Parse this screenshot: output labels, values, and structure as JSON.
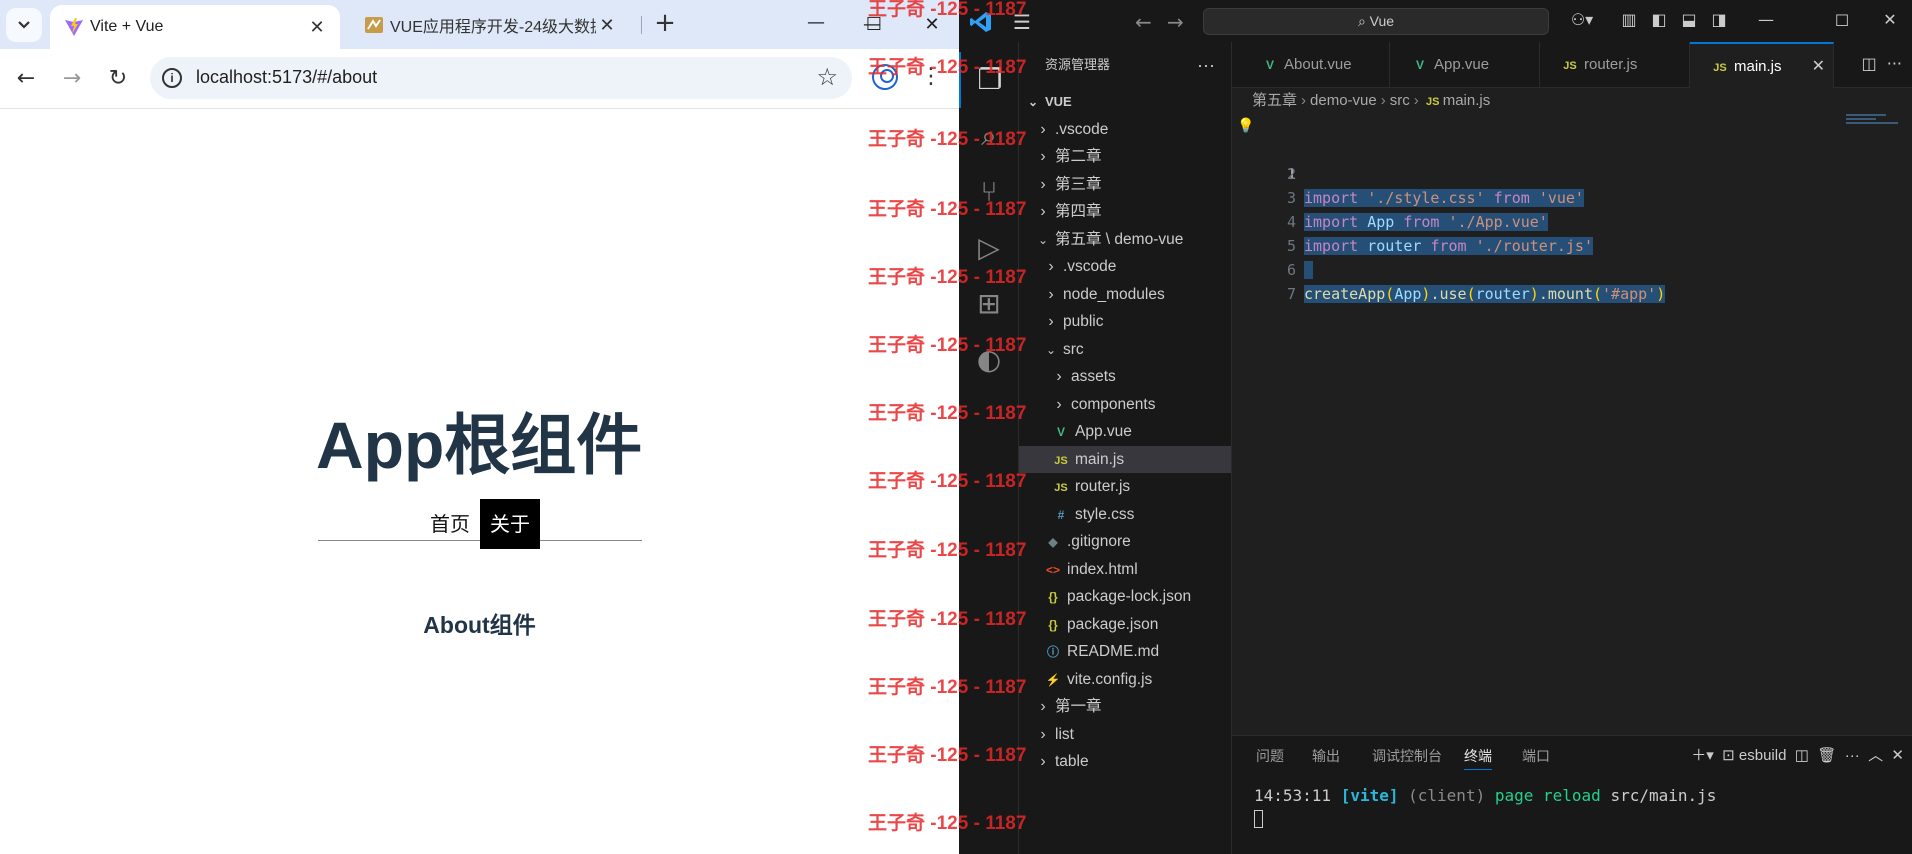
{
  "browser": {
    "tabs": [
      {
        "title": "Vite + Vue",
        "active": true
      },
      {
        "title": "VUE应用程序开发-24级大数据",
        "active": false
      }
    ],
    "url": "localhost:5173/#/about",
    "page": {
      "title": "App根组件",
      "nav": [
        {
          "label": "首页",
          "active": false
        },
        {
          "label": "关于",
          "active": true
        }
      ],
      "content": "About组件"
    }
  },
  "watermark": {
    "text": "王子奇 -125 - 1187"
  },
  "vscode": {
    "search": "Vue",
    "explorer_title": "资源管理器",
    "tree": [
      {
        "label": "VUE",
        "depth": 0,
        "type": "root",
        "expanded": true
      },
      {
        "label": ".vscode",
        "depth": 1,
        "type": "folder",
        "expanded": false
      },
      {
        "label": "第二章",
        "depth": 1,
        "type": "folder",
        "expanded": false
      },
      {
        "label": "第三章",
        "depth": 1,
        "type": "folder",
        "expanded": false
      },
      {
        "label": "第四章",
        "depth": 1,
        "type": "folder",
        "expanded": false
      },
      {
        "label": "第五章 \\ demo-vue",
        "depth": 1,
        "type": "folder",
        "expanded": true
      },
      {
        "label": ".vscode",
        "depth": 2,
        "type": "folder",
        "expanded": false
      },
      {
        "label": "node_modules",
        "depth": 2,
        "type": "folder",
        "expanded": false
      },
      {
        "label": "public",
        "depth": 2,
        "type": "folder",
        "expanded": false
      },
      {
        "label": "src",
        "depth": 2,
        "type": "folder",
        "expanded": true
      },
      {
        "label": "assets",
        "depth": 3,
        "type": "folder",
        "expanded": false
      },
      {
        "label": "components",
        "depth": 3,
        "type": "folder",
        "expanded": false
      },
      {
        "label": "App.vue",
        "depth": 3,
        "type": "vue"
      },
      {
        "label": "main.js",
        "depth": 3,
        "type": "js",
        "selected": true
      },
      {
        "label": "router.js",
        "depth": 3,
        "type": "js"
      },
      {
        "label": "style.css",
        "depth": 3,
        "type": "css"
      },
      {
        "label": ".gitignore",
        "depth": 2,
        "type": "git"
      },
      {
        "label": "index.html",
        "depth": 2,
        "type": "html"
      },
      {
        "label": "package-lock.json",
        "depth": 2,
        "type": "json"
      },
      {
        "label": "package.json",
        "depth": 2,
        "type": "json"
      },
      {
        "label": "README.md",
        "depth": 2,
        "type": "info"
      },
      {
        "label": "vite.config.js",
        "depth": 2,
        "type": "vite"
      },
      {
        "label": "第一章",
        "depth": 1,
        "type": "folder",
        "expanded": false
      },
      {
        "label": "list",
        "depth": 1,
        "type": "folder",
        "expanded": false
      },
      {
        "label": "table",
        "depth": 1,
        "type": "folder",
        "expanded": false
      }
    ],
    "editor_tabs": [
      {
        "label": "About.vue",
        "type": "vue",
        "active": false
      },
      {
        "label": "App.vue",
        "type": "vue",
        "active": false
      },
      {
        "label": "router.js",
        "type": "js",
        "active": false
      },
      {
        "label": "main.js",
        "type": "js",
        "active": true
      }
    ],
    "breadcrumbs": [
      "第五章",
      "demo-vue",
      "src",
      "main.js"
    ],
    "code_lines": [
      "1",
      "2",
      "3",
      "4",
      "5",
      "6",
      "7"
    ],
    "code": {
      "l1": [
        "import",
        "{",
        "createApp",
        "}",
        "from",
        "'vue'"
      ],
      "l2": [
        "import",
        "'./style.css'"
      ],
      "l3": [
        "import",
        "App",
        "from",
        "'./App.vue'"
      ],
      "l4": [
        "import",
        "router",
        "from",
        "'./router.js'"
      ],
      "l6": [
        "createApp",
        "(",
        "App",
        ")",
        ".use",
        "(",
        "router",
        ")",
        ".mount",
        "(",
        "'#app'",
        ")"
      ]
    },
    "panel_tabs": [
      "问题",
      "输出",
      "调试控制台",
      "终端",
      "端口"
    ],
    "panel_active": "终端",
    "terminal_name": "esbuild",
    "terminal": {
      "time": "14:53:11",
      "tag": "[vite]",
      "client": "(client)",
      "msg": "page reload",
      "file": "src/main.js"
    },
    "colors": {
      "accent": "#0078d4",
      "vue": "#41b883",
      "js": "#cbcb41"
    }
  }
}
